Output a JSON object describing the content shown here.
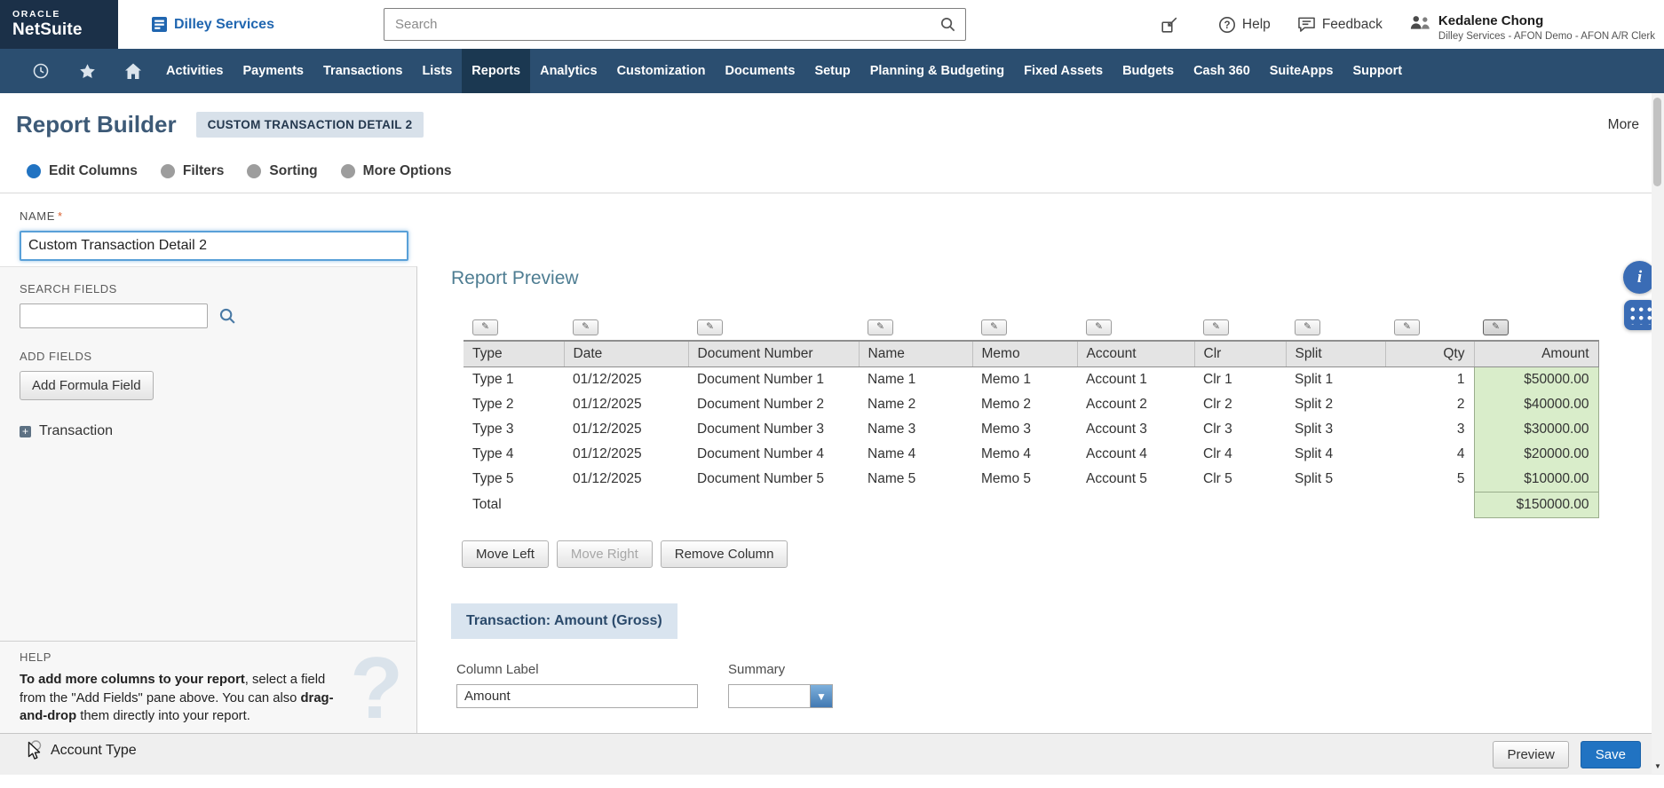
{
  "topbar": {
    "logo_oracle": "ORACLE",
    "logo_netsuite": "NetSuite",
    "company_name": "Dilley Services",
    "search_placeholder": "Search",
    "help_label": "Help",
    "feedback_label": "Feedback",
    "user_name": "Kedalene Chong",
    "user_role": "Dilley Services - AFON Demo - AFON A/R Clerk"
  },
  "nav": {
    "active": "Reports",
    "items": [
      "Activities",
      "Payments",
      "Transactions",
      "Lists",
      "Reports",
      "Analytics",
      "Customization",
      "Documents",
      "Setup",
      "Planning & Budgeting",
      "Fixed Assets",
      "Budgets",
      "Cash 360",
      "SuiteApps",
      "Support"
    ]
  },
  "header": {
    "title": "Report Builder",
    "badge": "CUSTOM TRANSACTION DETAIL 2",
    "more_label": "More"
  },
  "steps": [
    {
      "label": "Edit Columns",
      "active": true
    },
    {
      "label": "Filters",
      "active": false
    },
    {
      "label": "Sorting",
      "active": false
    },
    {
      "label": "More Options",
      "active": false
    }
  ],
  "sidebar": {
    "name_label": "NAME",
    "required_mark": "*",
    "name_value": "Custom Transaction Detail 2",
    "search_fields_label": "SEARCH FIELDS",
    "add_fields_label": "ADD FIELDS",
    "add_formula_label": "Add Formula Field",
    "tree_root": "Transaction",
    "help_label": "HELP",
    "help_bold_1": "To add more columns to your report",
    "help_text_1": ", select a field from the \"Add Fields\" pane above. You can also ",
    "help_bold_2": "drag-and-drop",
    "help_text_2": " them directly into your report.",
    "drag_field": "Account Type"
  },
  "preview": {
    "title": "Report Preview",
    "selected_column": "Amount",
    "columns": [
      "Type",
      "Date",
      "Document Number",
      "Name",
      "Memo",
      "Account",
      "Clr",
      "Split",
      "Qty",
      "Amount"
    ],
    "rows": [
      [
        "Type 1",
        "01/12/2025",
        "Document Number 1",
        "Name 1",
        "Memo 1",
        "Account 1",
        "Clr 1",
        "Split 1",
        "1",
        "$50000.00"
      ],
      [
        "Type 2",
        "01/12/2025",
        "Document Number 2",
        "Name 2",
        "Memo 2",
        "Account 2",
        "Clr 2",
        "Split 2",
        "2",
        "$40000.00"
      ],
      [
        "Type 3",
        "01/12/2025",
        "Document Number 3",
        "Name 3",
        "Memo 3",
        "Account 3",
        "Clr 3",
        "Split 3",
        "3",
        "$30000.00"
      ],
      [
        "Type 4",
        "01/12/2025",
        "Document Number 4",
        "Name 4",
        "Memo 4",
        "Account 4",
        "Clr 4",
        "Split 4",
        "4",
        "$20000.00"
      ],
      [
        "Type 5",
        "01/12/2025",
        "Document Number 5",
        "Name 5",
        "Memo 5",
        "Account 5",
        "Clr 5",
        "Split 5",
        "5",
        "$10000.00"
      ]
    ],
    "total_label": "Total",
    "total_amount": "$150000.00",
    "move_left_label": "Move Left",
    "move_right_label": "Move Right",
    "remove_column_label": "Remove Column",
    "field_editor": {
      "title": "Transaction: Amount (Gross)",
      "column_label_label": "Column Label",
      "column_label_value": "Amount",
      "summary_label": "Summary",
      "summary_value": ""
    }
  },
  "footer": {
    "preview_label": "Preview",
    "save_label": "Save"
  },
  "icons": {
    "edit-column-icon": "✎",
    "chevron-down-icon": "▼",
    "expand-plus-icon": "+",
    "scrollbar-down-icon": "▼",
    "info-icon": "i"
  },
  "colors": {
    "nav_bg": "#2b4e70",
    "nav_active_bg": "#1b3851",
    "accent_blue": "#2173c2",
    "selected_col_bg": "#d9edca",
    "badge_bg": "#d8e1ea",
    "section_header_bg": "#d9e4ef"
  }
}
